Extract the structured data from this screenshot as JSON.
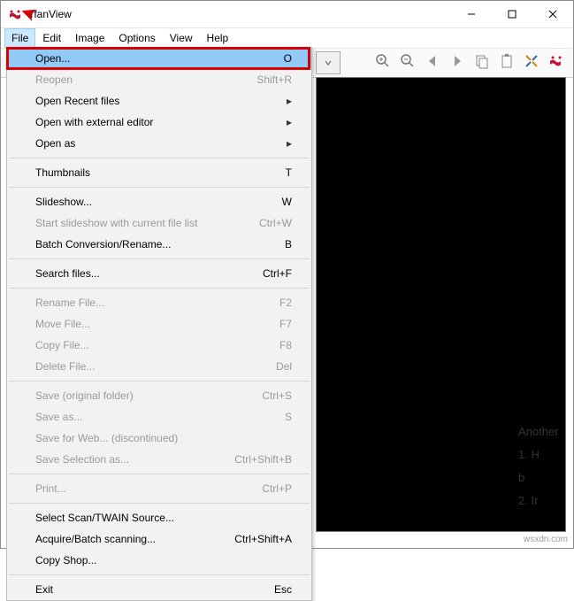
{
  "app": {
    "title": "IrfanView"
  },
  "menubar": [
    "File",
    "Edit",
    "Image",
    "Options",
    "View",
    "Help"
  ],
  "menubar_active_index": 0,
  "toolbar_icons": [
    "zoom-in-icon",
    "zoom-out-icon",
    "arrow-left-icon",
    "arrow-right-icon",
    "copy-icon",
    "paste-icon",
    "tools-icon",
    "irfan-icon"
  ],
  "file_menu": [
    {
      "label": "Open...",
      "accel": "O",
      "sel": true
    },
    {
      "label": "Reopen",
      "accel": "Shift+R",
      "disabled": true
    },
    {
      "label": "Open Recent files",
      "sub": true
    },
    {
      "label": "Open with external editor",
      "sub": true
    },
    {
      "label": "Open as",
      "sub": true
    },
    {
      "sep": true
    },
    {
      "label": "Thumbnails",
      "accel": "T"
    },
    {
      "sep": true
    },
    {
      "label": "Slideshow...",
      "accel": "W"
    },
    {
      "label": "Start slideshow with current file list",
      "accel": "Ctrl+W",
      "disabled": true
    },
    {
      "label": "Batch Conversion/Rename...",
      "accel": "B"
    },
    {
      "sep": true
    },
    {
      "label": "Search files...",
      "accel": "Ctrl+F"
    },
    {
      "sep": true
    },
    {
      "label": "Rename File...",
      "accel": "F2",
      "disabled": true
    },
    {
      "label": "Move File...",
      "accel": "F7",
      "disabled": true
    },
    {
      "label": "Copy File...",
      "accel": "F8",
      "disabled": true
    },
    {
      "label": "Delete File...",
      "accel": "Del",
      "disabled": true
    },
    {
      "sep": true
    },
    {
      "label": "Save (original folder)",
      "accel": "Ctrl+S",
      "disabled": true
    },
    {
      "label": "Save as...",
      "accel": "S",
      "disabled": true
    },
    {
      "label": "Save for Web... (discontinued)",
      "disabled": true
    },
    {
      "label": "Save Selection as...",
      "accel": "Ctrl+Shift+B",
      "disabled": true
    },
    {
      "sep": true
    },
    {
      "label": "Print...",
      "accel": "Ctrl+P",
      "disabled": true
    },
    {
      "sep": true
    },
    {
      "label": "Select Scan/TWAIN Source..."
    },
    {
      "label": "Acquire/Batch scanning...",
      "accel": "Ctrl+Shift+A"
    },
    {
      "label": "Copy Shop..."
    },
    {
      "sep": true
    },
    {
      "label": "Exit",
      "accel": "Esc"
    }
  ],
  "doc_lines": [
    "Another",
    "1.   H",
    "b",
    "2.   Ir"
  ],
  "watermark": "wsxdn.com"
}
